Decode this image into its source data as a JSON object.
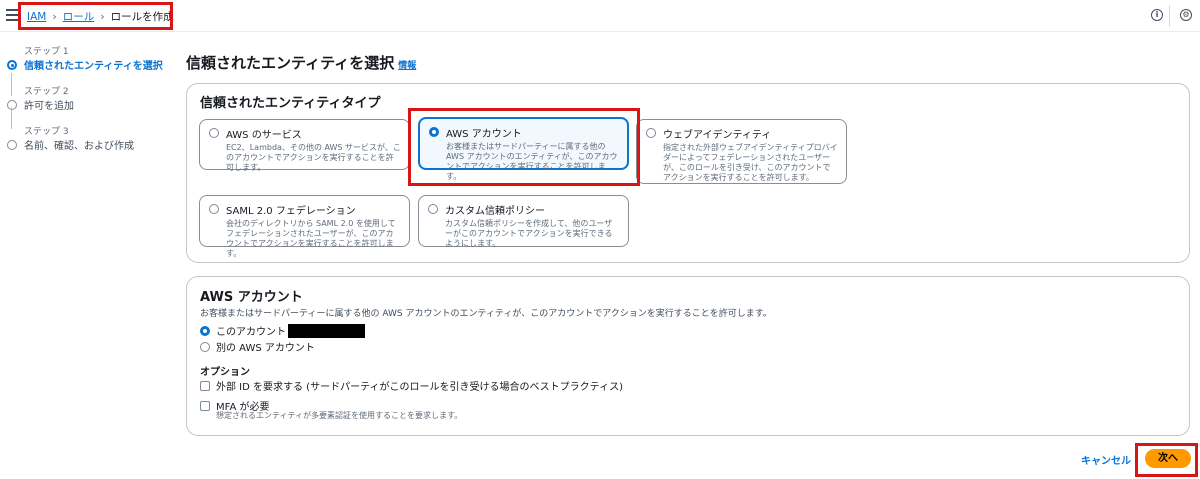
{
  "breadcrumb": {
    "items": [
      "IAM",
      "ロール"
    ],
    "current": "ロールを作成"
  },
  "header_icons": [
    "info-icon",
    "settings-icon"
  ],
  "steps": [
    {
      "label": "ステップ 1",
      "name": "信頼されたエンティティを選択",
      "active": true
    },
    {
      "label": "ステップ 2",
      "name": "許可を追加",
      "active": false
    },
    {
      "label": "ステップ 3",
      "name": "名前、確認、および作成",
      "active": false
    }
  ],
  "page": {
    "title": "信頼されたエンティティを選択",
    "info_link": "情報"
  },
  "entity_type": {
    "title": "信頼されたエンティティタイプ",
    "options": [
      {
        "title": "AWS のサービス",
        "desc": "EC2、Lambda、その他の AWS サービスが、このアカウントでアクションを実行することを許可します。",
        "selected": false
      },
      {
        "title": "AWS アカウント",
        "desc": "お客様またはサードパーティーに属する他の AWS アカウントのエンティティが、このアカウントでアクションを実行することを許可します。",
        "selected": true
      },
      {
        "title": "ウェブアイデンティティ",
        "desc": "指定された外部ウェブアイデンティティプロバイダーによってフェデレーションされたユーザーが、このロールを引き受け、このアカウントでアクションを実行することを許可します。",
        "selected": false
      },
      {
        "title": "SAML 2.0 フェデレーション",
        "desc": "会社のディレクトリから SAML 2.0 を使用してフェデレーションされたユーザーが、このアカウントでアクションを実行することを許可します。",
        "selected": false
      },
      {
        "title": "カスタム信頼ポリシー",
        "desc": "カスタム信頼ポリシーを作成して、他のユーザーがこのアカウントでアクションを実行できるようにします。",
        "selected": false
      }
    ]
  },
  "aws_account": {
    "title": "AWS アカウント",
    "desc": "お客様またはサードパーティーに属する他の AWS アカウントのエンティティが、このアカウントでアクションを実行することを許可します。",
    "this_account": "このアカウント",
    "other_account": "別の AWS アカウント",
    "options_title": "オプション",
    "external_id": "外部 ID を要求する (サードパーティがこのロールを引き受ける場合のベストプラクティス)",
    "mfa": "MFA が必要",
    "mfa_desc": "想定されるエンティティが多要素認証を使用することを要求します。"
  },
  "footer": {
    "cancel": "キャンセル",
    "next": "次へ"
  }
}
